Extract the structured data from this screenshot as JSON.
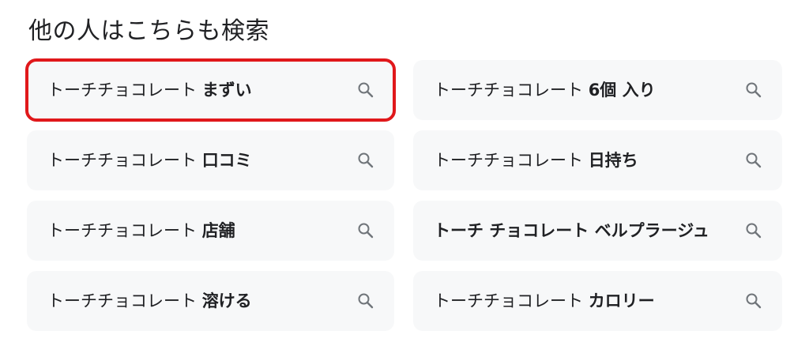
{
  "heading": "他の人はこちらも検索",
  "suggestions": [
    {
      "base": "トーチチョコレート ",
      "bold": "まずい"
    },
    {
      "base": "トーチチョコレート ",
      "bold": "6個 入り"
    },
    {
      "base": "トーチチョコレート ",
      "bold": "口コミ"
    },
    {
      "base": "トーチチョコレート ",
      "bold": "日持ち"
    },
    {
      "base": "トーチチョコレート ",
      "bold": "店舗"
    },
    {
      "base": "トーチ チョコレート ベルプラージュ",
      "bold": ""
    },
    {
      "base": "トーチチョコレート ",
      "bold": "溶ける"
    },
    {
      "base": "トーチチョコレート ",
      "bold": "カロリー"
    }
  ],
  "icon": "search-icon",
  "colors": {
    "chip_bg": "#f7f8f9",
    "highlight_border": "#e0181b",
    "text": "#202124",
    "icon": "#70757a"
  }
}
